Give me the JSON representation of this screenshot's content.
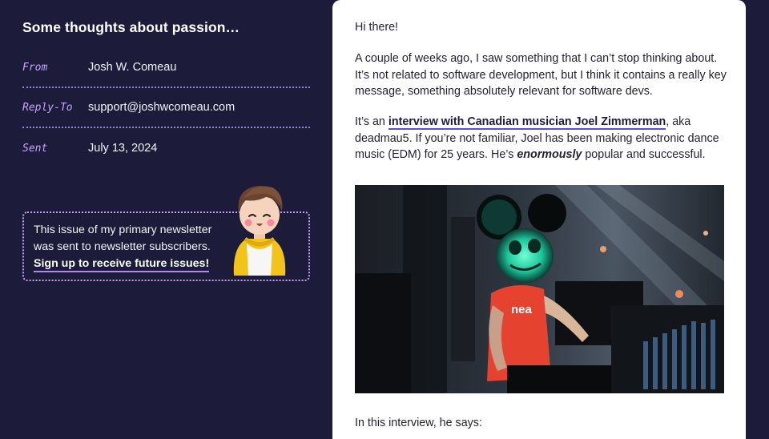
{
  "sidebar": {
    "subject": "Some thoughts about passion…",
    "meta": [
      {
        "label": "From",
        "value": "Josh W. Comeau"
      },
      {
        "label": "Reply-To",
        "value": "support@joshwcomeau.com"
      },
      {
        "label": "Sent",
        "value": "July 13, 2024"
      }
    ],
    "notice": {
      "line1": "This issue of my primary newsletter",
      "line2": "was sent to newsletter subscribers.",
      "cta": "Sign up to receive future issues!"
    }
  },
  "email": {
    "greeting": "Hi there!",
    "p2": "A couple of weeks ago, I saw something that I can’t stop thinking about. It’s not related to software development, but I think it contains a really key message, something absolutely relevant for software devs.",
    "p3_prefix": "It’s an ",
    "p3_link": "interview with Canadian musician Joel Zimmerman",
    "p3_mid": ", aka deadmau5. If you’re not familiar, Joel has been making electronic dance music (EDM) for 25 years. He’s ",
    "p3_emph": "enormously",
    "p3_suffix": " popular and successful.",
    "photo_shirt_text": "nea",
    "p4": "In this interview, he says:"
  },
  "colors": {
    "background": "#1d1b3a",
    "card": "#ffffff",
    "label_purple": "#c6a4ff",
    "link_underline": "#5b4fd6",
    "dotted_border": "#c5a0f5"
  }
}
